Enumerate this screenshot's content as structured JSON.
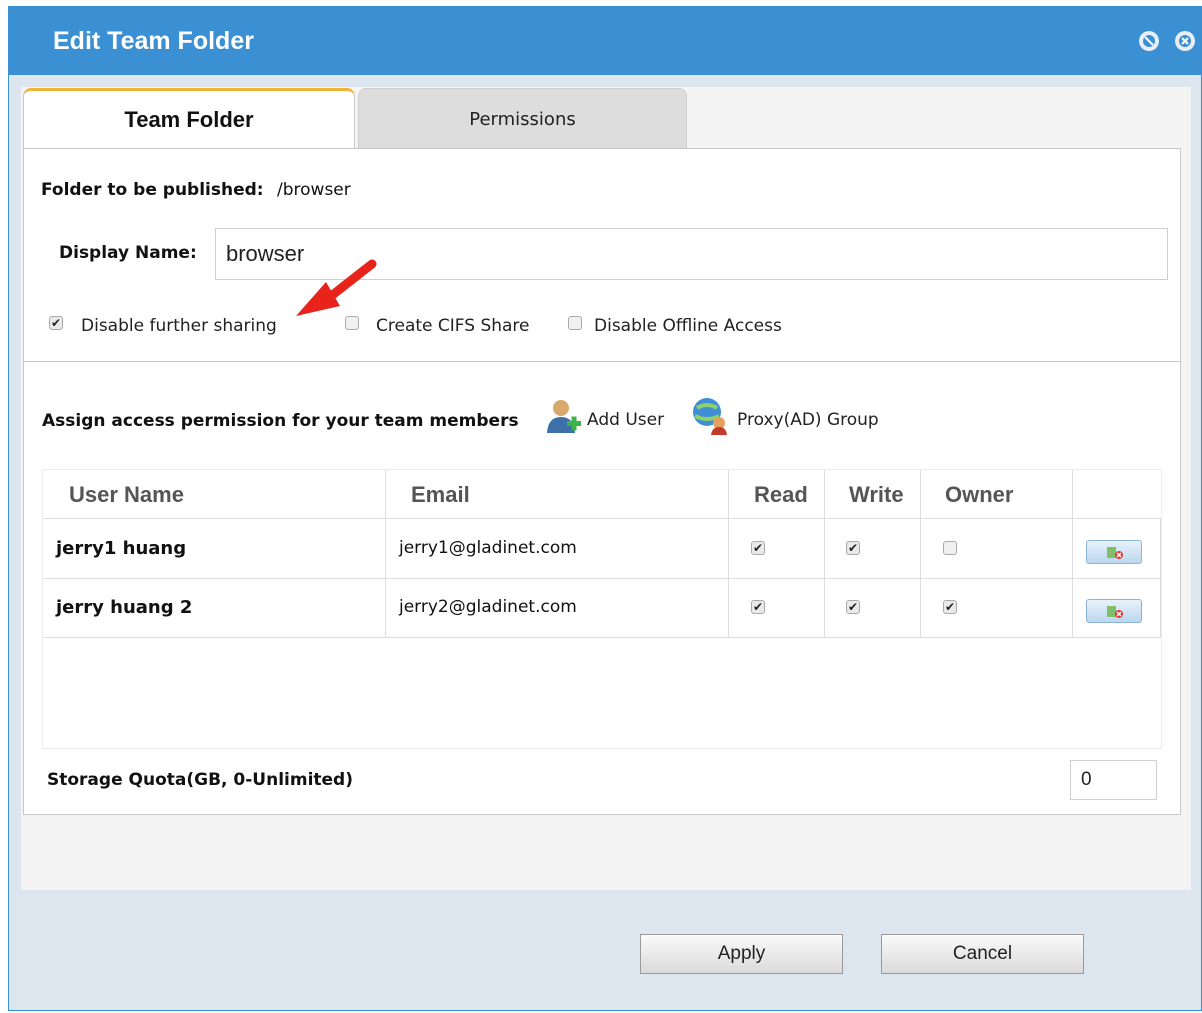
{
  "dialog": {
    "title": "Edit Team Folder",
    "title_icons": [
      "minimize-icon",
      "close-icon"
    ]
  },
  "tabs": [
    {
      "label": "Team Folder",
      "active": true
    },
    {
      "label": "Permissions",
      "active": false
    }
  ],
  "folder": {
    "published_label": "Folder to be published:",
    "published_path": "/browser",
    "display_name_label": "Display Name:",
    "display_name_value": "browser"
  },
  "options": [
    {
      "label": "Disable further sharing",
      "checked": true
    },
    {
      "label": "Create CIFS Share",
      "checked": false
    },
    {
      "label": "Disable Offline Access",
      "checked": false
    }
  ],
  "annotation": {
    "color": "#e8231c",
    "icon": "red-arrow-icon"
  },
  "assign": {
    "label": "Assign access permission for your team members",
    "add_user": "Add User",
    "proxy_group": "Proxy(AD) Group"
  },
  "table": {
    "columns": [
      "User Name",
      "Email",
      "Read",
      "Write",
      "Owner"
    ],
    "rows": [
      {
        "user": "jerry1 huang",
        "email": "jerry1@gladinet.com",
        "read": true,
        "write": true,
        "owner": false
      },
      {
        "user": "jerry huang 2",
        "email": "jerry2@gladinet.com",
        "read": true,
        "write": true,
        "owner": true
      }
    ]
  },
  "quota": {
    "label": "Storage Quota(GB, 0-Unlimited)",
    "value": "0"
  },
  "buttons": {
    "apply": "Apply",
    "cancel": "Cancel"
  },
  "colors": {
    "titlebar": "#3b8fd3",
    "tab_accent": "#f2b43a"
  }
}
